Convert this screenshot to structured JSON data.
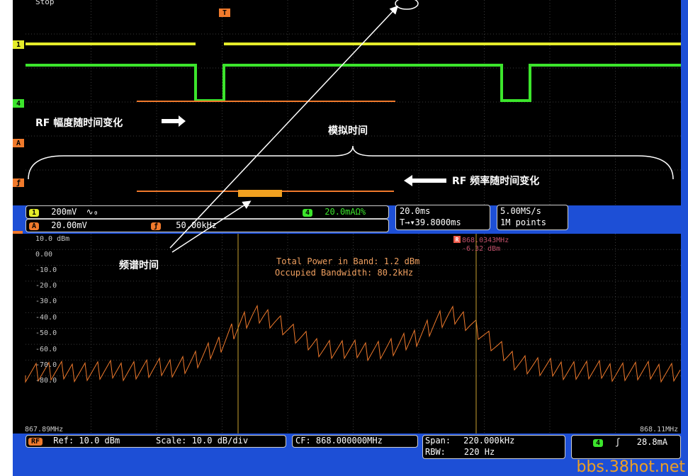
{
  "status": "Stop",
  "markers": {
    "ch1": "1",
    "ch4": "4",
    "math": "A",
    "f": "ƒ",
    "trigger": "T",
    "rf": "RF",
    "r": "R"
  },
  "annotations": {
    "rf_amp": "RF 幅度随时间变化",
    "analog_time": "模拟时间",
    "rf_freq": "RF 频率随时间变化",
    "spectrum_time": "频谱时间"
  },
  "info_panel": {
    "ch1_badge": "1",
    "ch1_scale": "200mV",
    "ch1_icons": "∿₀",
    "ch4_badge": "4",
    "ch4_scale": "20.0mAΩ%",
    "math_badge": "A",
    "math_scale": "20.00mV",
    "f_badge": "ƒ",
    "f_scale": "50.00kHz",
    "timebase": "20.0ms",
    "trigger_pos": "T→▾39.8000ms",
    "samplerate": "5.00MS/s",
    "record_len": "1M points"
  },
  "spectrum": {
    "marker_freq": "868.0343MHz",
    "marker_level": "-6.32 dBm",
    "total_power": "Total Power in Band: 1.2 dBm",
    "occupied_bw": "Occupied Bandwidth: 80.2kHz",
    "x_start": "867.89MHz",
    "x_end": "868.11MHz",
    "y_labels": [
      "10.0 dBm",
      "0.00",
      "-10.0",
      "-20.0",
      "-30.0",
      "-40.0",
      "-50.0",
      "-60.0",
      "-70.0",
      "-80.0"
    ]
  },
  "bottom_bar": {
    "rf_badge": "RF",
    "ref": "Ref: 10.0 dBm",
    "scale": "Scale: 10.0 dB/div",
    "cf": "CF: 868.000000MHz",
    "span_label": "Span:",
    "span_val": "220.000kHz",
    "rbw_label": "RBW:",
    "rbw_val": "220 Hz",
    "ch4_badge": "4",
    "trig_icon": "ʃ",
    "trig_level": "28.8mA"
  },
  "watermark": "bbs.38hot.net",
  "colors": {
    "ch1": "#e4ec2a",
    "ch4": "#3ce52c",
    "rf": "#f07a2c",
    "frame": "#1d4fd6"
  }
}
